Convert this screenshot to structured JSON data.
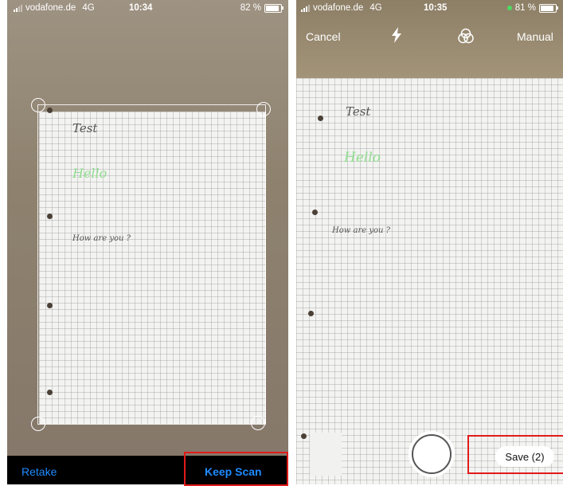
{
  "left_screen": {
    "status": {
      "carrier": "vodafone.de",
      "network": "4G",
      "time": "10:34",
      "battery": "82 %",
      "battery_level": 0.82
    },
    "paper": {
      "line1": "Test",
      "line2": "Hello",
      "line3": "How are you ?"
    },
    "bottom_bar": {
      "retake_label": "Retake",
      "keep_scan_label": "Keep Scan"
    }
  },
  "right_screen": {
    "status": {
      "carrier": "vodafone.de",
      "network": "4G",
      "time": "10:35",
      "battery": "81 %",
      "battery_level": 0.81
    },
    "top_bar": {
      "cancel_label": "Cancel",
      "mode_label": "Manual"
    },
    "paper": {
      "line1": "Test",
      "line2": "Hello",
      "line3": "How are you ?"
    },
    "bottom_bar": {
      "save_label": "Save (2)"
    }
  },
  "colors": {
    "accent_blue": "#1f8bff",
    "highlight_red": "#e21b1b",
    "handwriting_green": "#8fdc8f"
  },
  "icons": {
    "flash": "flash-icon",
    "filters": "filters-icon",
    "shutter": "shutter-button"
  }
}
